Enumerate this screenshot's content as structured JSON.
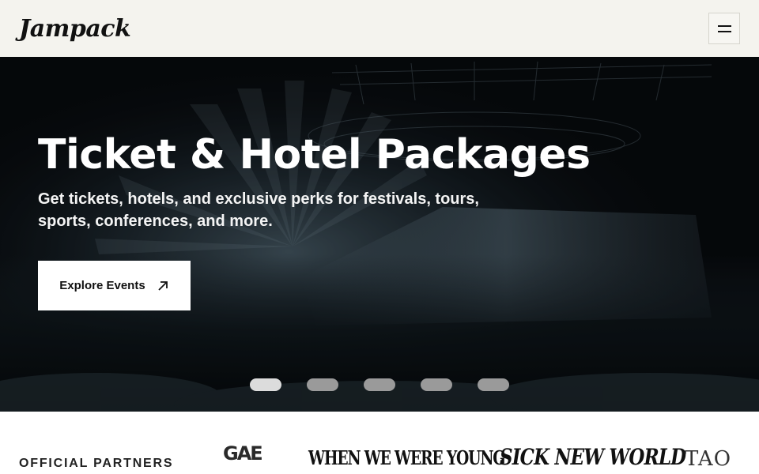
{
  "header": {
    "logo_text": "Jampack",
    "menu_icon": "hamburger-menu-icon"
  },
  "hero": {
    "title": "Ticket & Hotel Packages",
    "subtitle": "Get tickets, hotels, and exclusive perks for festivals, tours, sports, conferences, and more.",
    "cta_label": "Explore Events",
    "cta_icon": "arrow-up-right-icon",
    "background": "concert-arena-photo",
    "carousel": {
      "slide_count": 5,
      "active_index": 0
    }
  },
  "partners": {
    "label": "OFFICIAL PARTNERS",
    "logos": [
      "GAE UP",
      "WHEN WE WERE YOUNG",
      "SICK NEW WORLD",
      "TAO"
    ]
  },
  "colors": {
    "header_bg": "#f4f3ee",
    "cta_bg": "#ffffff",
    "dot_active": "#dcdcdc",
    "dot_inactive": "#9a9a9a"
  }
}
